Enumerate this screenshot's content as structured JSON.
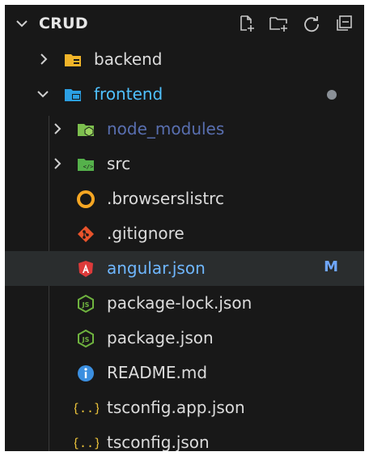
{
  "explorer": {
    "root_label": "CRUD",
    "actions": [
      {
        "icon": "new-file-icon"
      },
      {
        "icon": "new-folder-icon"
      },
      {
        "icon": "refresh-icon"
      },
      {
        "icon": "collapse-all-icon"
      }
    ]
  },
  "tree": [
    {
      "label": "backend",
      "kind": "folder",
      "expanded": false,
      "icon": "backend-folder-icon",
      "color": "#f0b429"
    },
    {
      "label": "frontend",
      "kind": "folder",
      "expanded": true,
      "icon": "frontend-folder-icon",
      "color": "#2b9fe3",
      "modified_dot": true
    },
    {
      "label": "node_modules",
      "kind": "folder",
      "expanded": false,
      "icon": "node-folder-icon",
      "color": "#7cbf4e"
    },
    {
      "label": "src",
      "kind": "folder",
      "expanded": false,
      "icon": "src-folder-icon",
      "color": "#55b14b"
    },
    {
      "label": ".browserslistrc",
      "kind": "file",
      "icon": "browserslist-icon",
      "color": "#f5a623"
    },
    {
      "label": ".gitignore",
      "kind": "file",
      "icon": "git-icon",
      "color": "#e8532b"
    },
    {
      "label": "angular.json",
      "kind": "file",
      "icon": "angular-icon",
      "color": "#dd3a3a",
      "selected": true,
      "git_status": "M"
    },
    {
      "label": "package-lock.json",
      "kind": "file",
      "icon": "nodejs-icon",
      "color": "#6fb33f"
    },
    {
      "label": "package.json",
      "kind": "file",
      "icon": "nodejs-icon",
      "color": "#6fb33f"
    },
    {
      "label": "README.md",
      "kind": "file",
      "icon": "info-icon",
      "color": "#3b8fe0"
    },
    {
      "label": "tsconfig.app.json",
      "kind": "file",
      "icon": "json-braces-icon",
      "color": "#e8c03a"
    },
    {
      "label": "tsconfig.json",
      "kind": "file",
      "icon": "json-braces-icon",
      "color": "#e8c03a"
    }
  ]
}
